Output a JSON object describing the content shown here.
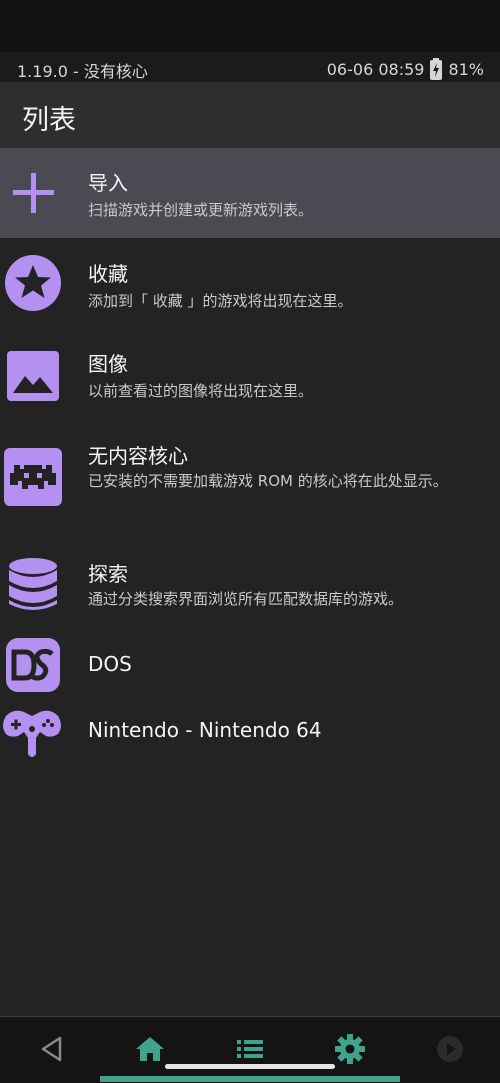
{
  "status": {
    "left": "1.19.0 - 没有核心",
    "datetime": "06-06 08:59",
    "battery": "81%"
  },
  "header": {
    "title": "列表"
  },
  "items": [
    {
      "icon": "plus-icon",
      "title": "导入",
      "sub": "扫描游戏并创建或更新游戏列表。"
    },
    {
      "icon": "star-icon",
      "title": "收藏",
      "sub": "添加到「 收藏 」的游戏将出现在这里。"
    },
    {
      "icon": "image-icon",
      "title": "图像",
      "sub": "以前查看过的图像将出现在这里。"
    },
    {
      "icon": "invader-icon",
      "title": "无内容核心",
      "sub": "已安装的不需要加载游戏 ROM 的核心将在此处显示。"
    },
    {
      "icon": "database-icon",
      "title": "探索",
      "sub": "通过分类搜索界面浏览所有匹配数据库的游戏。"
    },
    {
      "icon": "dos-icon",
      "title": "DOS"
    },
    {
      "icon": "gamepad-icon",
      "title": "Nintendo - Nintendo 64"
    }
  ],
  "nav": [
    "back-icon",
    "home-icon",
    "list-icon",
    "gear-icon",
    "play-icon"
  ],
  "colors": {
    "accent": "#b491f0",
    "selected": "#4a4a52",
    "nav_active": "#3fa48b"
  }
}
